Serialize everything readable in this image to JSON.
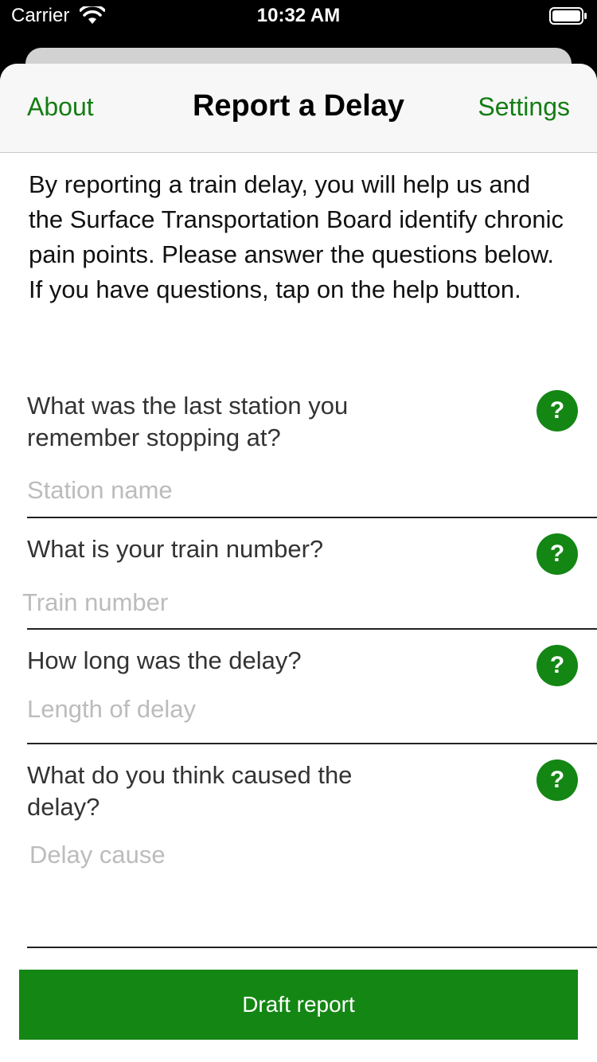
{
  "status_bar": {
    "carrier": "Carrier",
    "time": "10:32 AM",
    "wifi_icon": "wifi-icon",
    "battery_icon": "battery-icon"
  },
  "nav": {
    "left": "About",
    "title": "Report a Delay",
    "right": "Settings",
    "accent_color": "#137d13"
  },
  "intro": "By reporting a train delay, you will help us and the Surface Transportation Board identify chronic pain points. Please answer the questions below.  If you have questions, tap on the help button.",
  "questions": [
    {
      "label": "What was the last station you remember stopping at?",
      "placeholder": "Station name",
      "help": "?"
    },
    {
      "label": "What is your train number?",
      "placeholder": "Train number",
      "help": "?"
    },
    {
      "label": "How long was the delay?",
      "placeholder": "Length of delay",
      "help": "?"
    },
    {
      "label": "What do you think caused the delay?",
      "placeholder": "Delay cause",
      "help": "?"
    }
  ],
  "draft_button": "Draft report",
  "button_color": "#148614"
}
